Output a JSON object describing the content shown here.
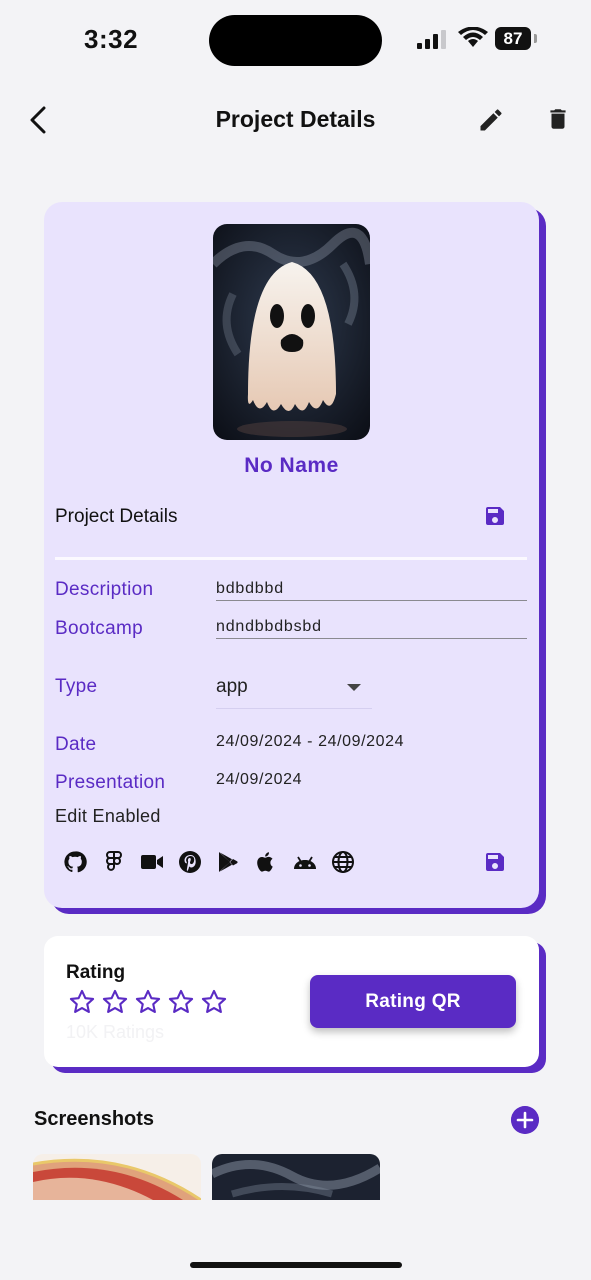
{
  "status": {
    "time": "3:32",
    "battery": "87"
  },
  "nav": {
    "title": "Project Details"
  },
  "project": {
    "name": "No Name",
    "section_title": "Project Details",
    "fields": {
      "description_label": "Description",
      "description_value": "bdbdbbd",
      "bootcamp_label": "Bootcamp",
      "bootcamp_value": "ndndbbdbsbd",
      "type_label": "Type",
      "type_value": "app",
      "date_label": "Date",
      "date_value": "24/09/2024 - 24/09/2024",
      "presentation_label": "Presentation",
      "presentation_value": "24/09/2024"
    },
    "edit_enabled": "Edit Enabled",
    "links": [
      "github-icon",
      "figma-icon",
      "video-icon",
      "pinterest-icon",
      "google-play-icon",
      "apple-icon",
      "android-icon",
      "web-icon"
    ]
  },
  "rating": {
    "title": "Rating",
    "stars_filled": 0,
    "stars_total": 5,
    "count": "10K Ratings",
    "qr_button": "Rating QR"
  },
  "screenshots": {
    "title": "Screenshots"
  },
  "colors": {
    "accent": "#5a2bc4",
    "card_bg": "#e9e3fd",
    "page_bg": "#f3f3f6"
  }
}
